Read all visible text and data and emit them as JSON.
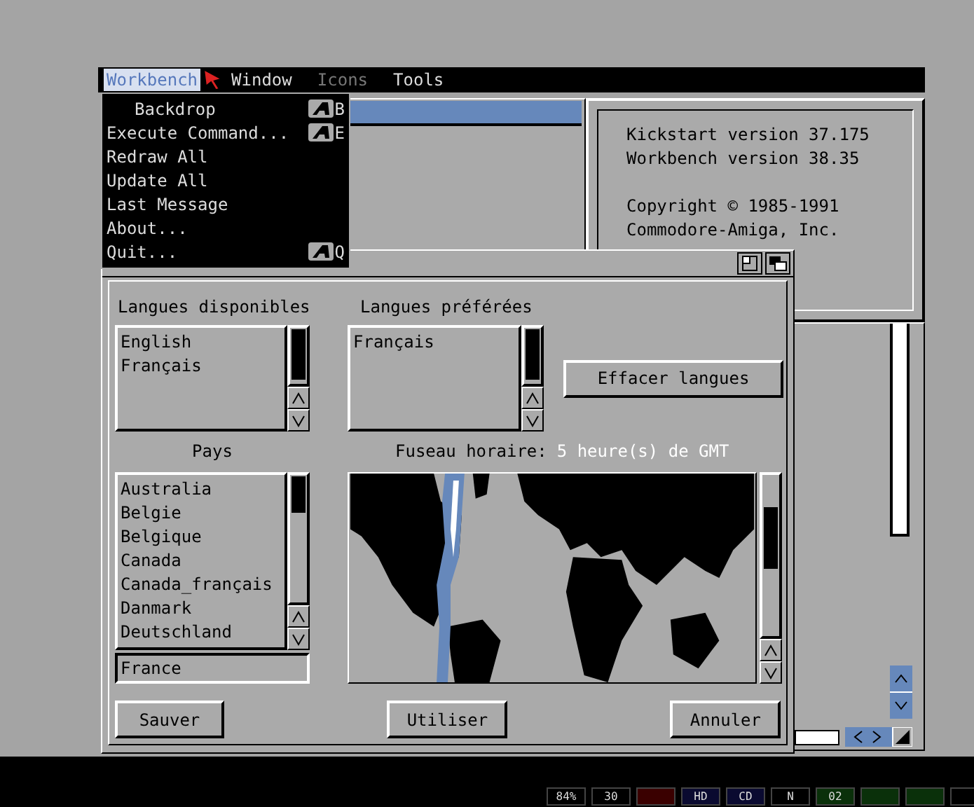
{
  "menu_bar": {
    "items": [
      {
        "label": "Workbench",
        "selected": true,
        "disabled": false
      },
      {
        "label": "Window",
        "selected": false,
        "disabled": false
      },
      {
        "label": "Icons",
        "selected": false,
        "disabled": true
      },
      {
        "label": "Tools",
        "selected": false,
        "disabled": false
      }
    ]
  },
  "menu": {
    "items": [
      {
        "kind": "toggle",
        "label": "Backdrop",
        "shortcut": "B"
      },
      {
        "kind": "command",
        "label": "Execute Command...",
        "shortcut": "E"
      },
      {
        "kind": "command",
        "label": "Redraw All"
      },
      {
        "kind": "command",
        "label": "Update All"
      },
      {
        "kind": "command",
        "label": "Last Message"
      },
      {
        "kind": "command",
        "label": "About..."
      },
      {
        "kind": "command",
        "label": "Quit...",
        "shortcut": "Q"
      }
    ]
  },
  "about": {
    "version_lines": [
      "Kickstart version 37.175",
      "Workbench version 38.35"
    ],
    "copyright_lines": [
      "Copyright © 1985-1991",
      "Commodore-Amiga, Inc."
    ]
  },
  "prefs": {
    "available_label": "Langues disponibles",
    "available": [
      "English",
      "Français"
    ],
    "preferred_label": "Langues préférées",
    "preferred": [
      "Français"
    ],
    "clear_button": "Effacer langues",
    "country_label": "Pays",
    "countries": [
      "Australia",
      "Belgie",
      "Belgique",
      "Canada",
      "Canada_français",
      "Danmark",
      "Deutschland"
    ],
    "country_value": "France",
    "timezone_label": "Fuseau horaire:",
    "timezone_value": "5 heure(s) de GMT",
    "buttons": [
      "Sauver",
      "Utiliser",
      "Annuler"
    ]
  },
  "status_bar": {
    "leds": [
      {
        "label": "84%",
        "color": "#000000"
      },
      {
        "label": "30",
        "color": "#000000"
      },
      {
        "color": "#3a0000"
      },
      {
        "label": "HD",
        "color": "#0a0a30"
      },
      {
        "label": "CD",
        "color": "#0a0a30"
      },
      {
        "label": "N",
        "color": "#000000"
      },
      {
        "label": "02",
        "color": "#0a300a"
      },
      {
        "color": "#0a300a"
      },
      {
        "color": "#0a300a"
      },
      {
        "color": "#000000"
      }
    ]
  }
}
